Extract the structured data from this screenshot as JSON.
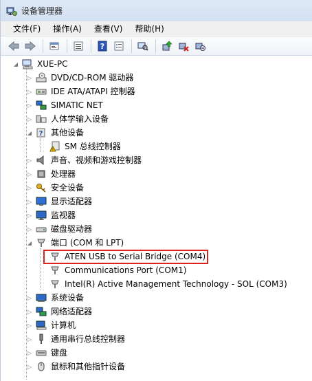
{
  "window": {
    "title": "设备管理器"
  },
  "menu": [
    "文件(F)",
    "操作(A)",
    "查看(V)",
    "帮助(H)"
  ],
  "toolbar": [
    "back-icon",
    "forward-icon",
    "properties-icon",
    "view-icon",
    "help-icon",
    "list-icon",
    "scan-hardware-icon",
    "update-driver-icon",
    "disable-device-icon",
    "uninstall-device-icon"
  ],
  "tree": {
    "root": "XUE-PC",
    "items": [
      {
        "label": "DVD/CD-ROM 驱动器"
      },
      {
        "label": "IDE ATA/ATAPI 控制器"
      },
      {
        "label": "SIMATIC NET"
      },
      {
        "label": "人体学输入设备"
      },
      {
        "label": "其他设备"
      },
      {
        "label": "SM 总线控制器"
      },
      {
        "label": "声音、视频和游戏控制器"
      },
      {
        "label": "处理器"
      },
      {
        "label": "安全设备"
      },
      {
        "label": "显示适配器"
      },
      {
        "label": "监视器"
      },
      {
        "label": "磁盘驱动器"
      },
      {
        "label": "端口 (COM 和 LPT)"
      },
      {
        "label": "ATEN USB to Serial Bridge (COM4)"
      },
      {
        "label": "Communications Port (COM1)"
      },
      {
        "label": "Intel(R) Active Management Technology - SOL (COM3)"
      },
      {
        "label": "系统设备"
      },
      {
        "label": "网络适配器"
      },
      {
        "label": "计算机"
      },
      {
        "label": "通用串行总线控制器"
      },
      {
        "label": "键盘"
      },
      {
        "label": "鼠标和其他指针设备"
      }
    ]
  }
}
